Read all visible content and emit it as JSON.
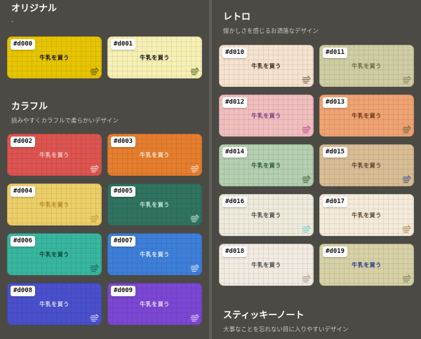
{
  "sections": {
    "original": {
      "title": "オリジナル",
      "subtitle": "-"
    },
    "colorful": {
      "title": "カラフル",
      "subtitle": "読みやすくカラフルで柔らかいデザイン"
    },
    "retro": {
      "title": "レトロ",
      "subtitle": "懐かしさを感じるお洒落なデザイン"
    },
    "sticky": {
      "title": "スティッキーノート",
      "subtitle": "大事なことを忘れない目に入りやすいデザイン"
    }
  },
  "memo_text": "牛乳を買う",
  "cards": [
    {
      "id": "#d000",
      "bg": "#e6c500",
      "text": "#111111",
      "icon": "#6b5a00"
    },
    {
      "id": "#d001",
      "bg": "#f7f0b4",
      "text": "#111111",
      "icon": "#5b6e2a"
    },
    {
      "id": "#d002",
      "bg": "#dd5450",
      "text": "#f6c5bf",
      "icon": "#f3d5c7"
    },
    {
      "id": "#d003",
      "bg": "#e57e2e",
      "text": "#fbe3c4",
      "icon": "#f6d7b2"
    },
    {
      "id": "#d004",
      "bg": "#edcf68",
      "text": "#b58b2a",
      "icon": "#c9a23e"
    },
    {
      "id": "#d005",
      "bg": "#2f7360",
      "text": "#c4e6d7",
      "icon": "#bfe0d0"
    },
    {
      "id": "#d006",
      "bg": "#38b6a0",
      "text": "#0f4b40",
      "icon": "#1f6e5f"
    },
    {
      "id": "#d007",
      "bg": "#3e7fd9",
      "text": "#d6e5fa",
      "icon": "#c8dbf7"
    },
    {
      "id": "#d008",
      "bg": "#4a50cc",
      "text": "#d3d6f7",
      "icon": "#c8cbf3"
    },
    {
      "id": "#d009",
      "bg": "#7b47d3",
      "text": "#e3d3f8",
      "icon": "#d9c6f4"
    },
    {
      "id": "#d010",
      "bg": "#f6e3cf",
      "text": "#3d2a1b",
      "icon": "#7a6a5c"
    },
    {
      "id": "#d011",
      "bg": "#cfcda3",
      "text": "#6d6a46",
      "icon": "#8a8a5e"
    },
    {
      "id": "#d012",
      "bg": "#f1bebe",
      "text": "#7d3f7e",
      "icon": "#c64f97"
    },
    {
      "id": "#d013",
      "bg": "#f0a373",
      "text": "#6a3b1c",
      "icon": "#6d6a46"
    },
    {
      "id": "#d014",
      "bg": "#b4cfb1",
      "text": "#2f5b3a",
      "icon": "#4a6d4b"
    },
    {
      "id": "#d015",
      "bg": "#d8bd95",
      "text": "#5a4630",
      "icon": "#4f5a8a"
    },
    {
      "id": "#d016",
      "bg": "#eeebdc",
      "text": "#4a4a4a",
      "icon": "#7fd0cd"
    },
    {
      "id": "#d017",
      "bg": "#f4ebdb",
      "text": "#5e4a33",
      "icon": "#b98d5a"
    },
    {
      "id": "#d018",
      "bg": "#f1ebe1",
      "text": "#4a4a4a",
      "icon": "#a9a29a"
    },
    {
      "id": "#d019",
      "bg": "#d6d1a6",
      "text": "#2d3a86",
      "icon": "#8a8a5e"
    }
  ]
}
